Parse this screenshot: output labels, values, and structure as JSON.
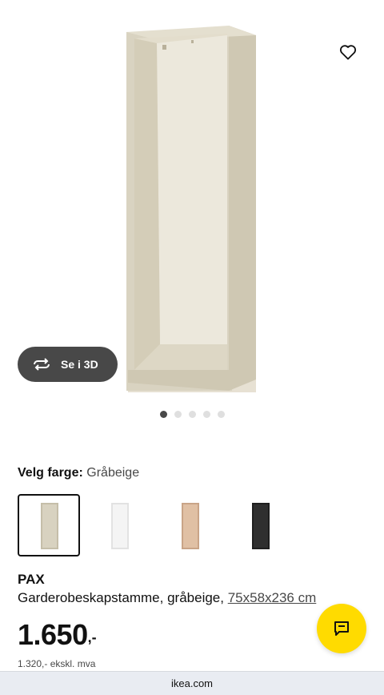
{
  "gallery": {
    "image_alt": "PAX wardrobe frame",
    "favorite_icon": "heart-icon",
    "view3d_label": "Se i 3D",
    "view3d_icon": "rotate-3d-icon",
    "dots": 5,
    "active_dot": 0
  },
  "color": {
    "label": "Velg farge:",
    "value": "Gråbeige",
    "swatches": [
      {
        "name": "Gråbeige",
        "color": "#d8d2c0",
        "selected": true
      },
      {
        "name": "Hvit",
        "color": "#f4f4f4",
        "selected": false
      },
      {
        "name": "Hvitbeiset eikeeffekt",
        "color": "#d9b79a",
        "selected": false
      },
      {
        "name": "Svartbrun",
        "color": "#2f2f2f",
        "selected": false
      }
    ]
  },
  "product": {
    "name": "PAX",
    "description": "Garderobeskapstamme, gråbeige, ",
    "dimensions": "75x58x236 cm"
  },
  "price": {
    "integer": "1.650",
    "decimal": ",-",
    "ex_vat": "1.320,- ekskl. mva"
  },
  "chat": {
    "icon": "chat-icon"
  },
  "browser": {
    "url": "ikea.com"
  },
  "colors": {
    "accent_yellow": "#ffdb00",
    "dark_button": "#484848"
  }
}
